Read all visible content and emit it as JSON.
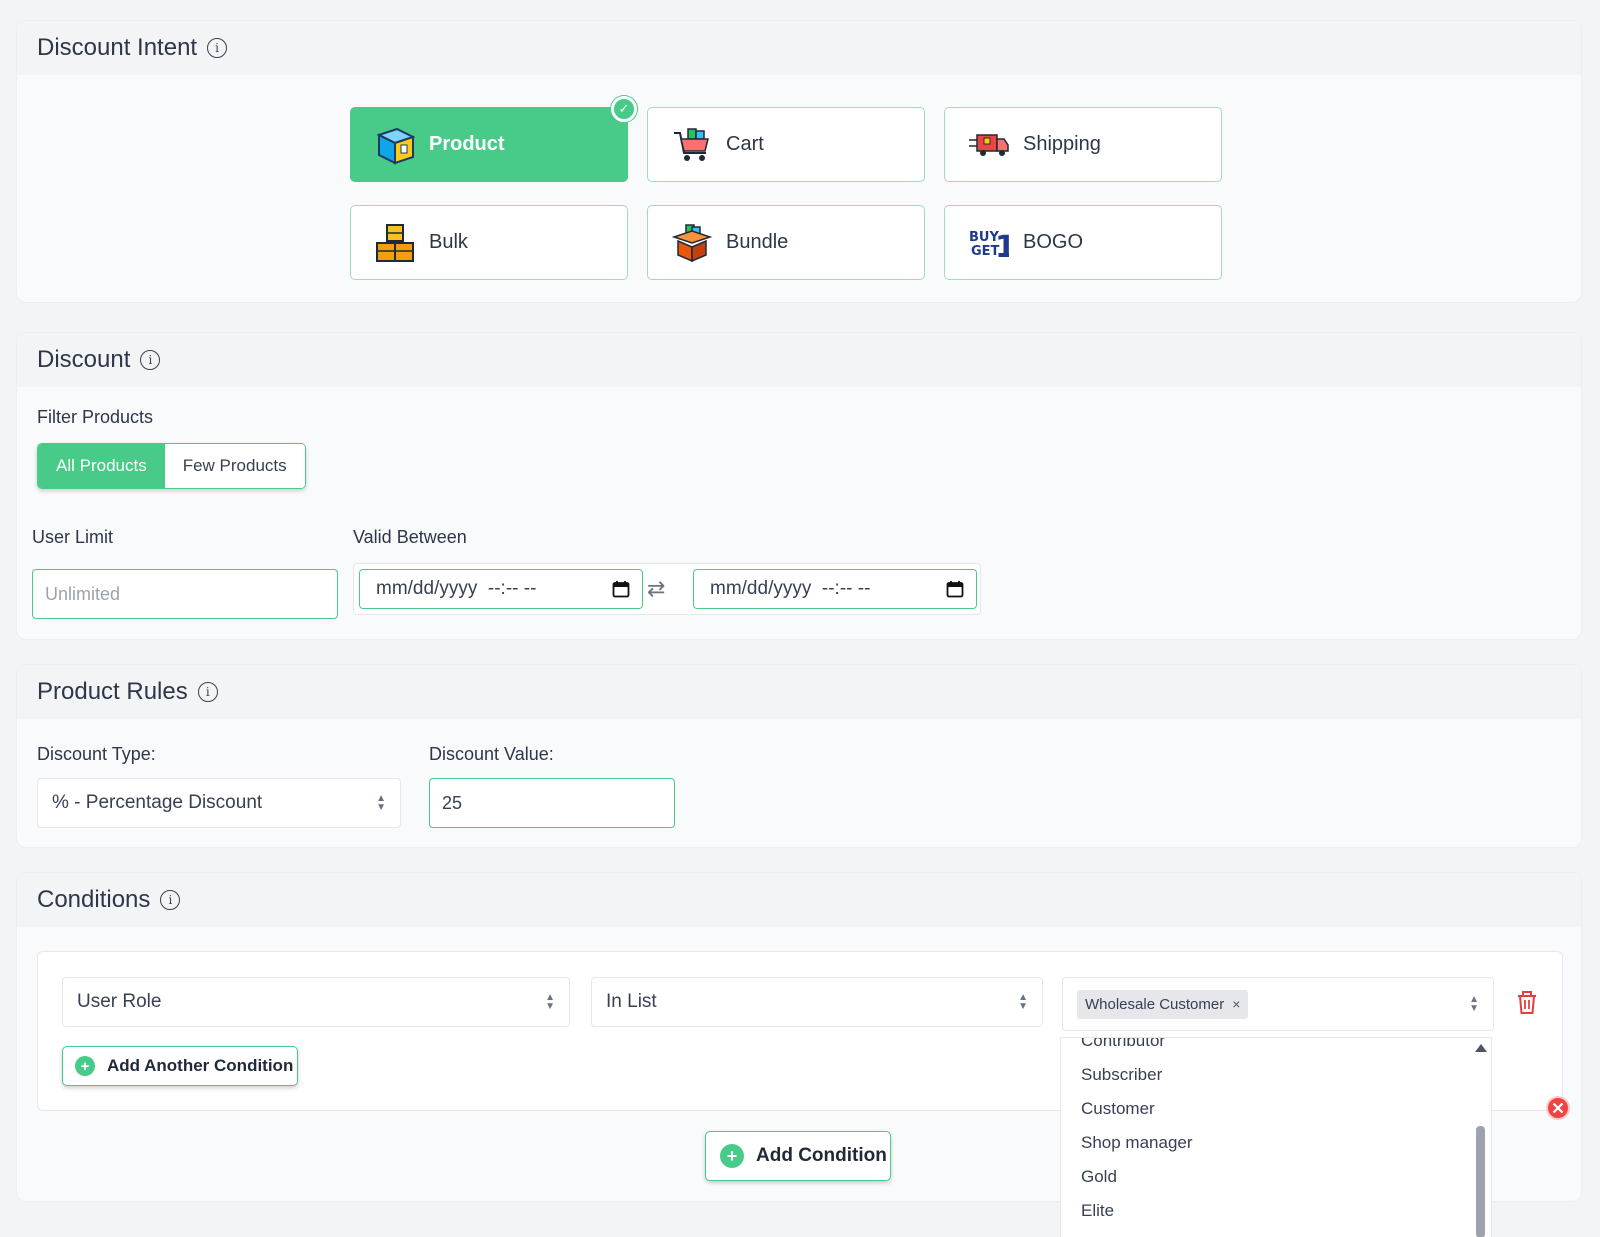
{
  "intent": {
    "title": "Discount Intent",
    "tiles": [
      {
        "label": "Product",
        "icon": "product-box-icon",
        "active": true
      },
      {
        "label": "Cart",
        "icon": "cart-icon"
      },
      {
        "label": "Shipping",
        "icon": "shipping-truck-icon"
      },
      {
        "label": "Bulk",
        "icon": "bulk-boxes-icon"
      },
      {
        "label": "Bundle",
        "icon": "bundle-box-icon"
      },
      {
        "label": "BOGO",
        "icon": "buy1-get1-icon"
      }
    ],
    "bogo_icon_text": {
      "buy": "BUY",
      "get": "GET",
      "num": "1"
    }
  },
  "discount": {
    "title": "Discount",
    "filter_label": "Filter Products",
    "filter_options": [
      "All Products",
      "Few Products"
    ],
    "user_limit_label": "User Limit",
    "user_limit_placeholder": "Unlimited",
    "valid_between_label": "Valid Between",
    "date_placeholder": "mm/dd/yyyy  --:-- --",
    "swap_symbol": "⇄"
  },
  "rules": {
    "title": "Product Rules",
    "type_label": "Discount Type:",
    "type_value": "% - Percentage Discount",
    "value_label": "Discount Value:",
    "value": "25"
  },
  "conditions": {
    "title": "Conditions",
    "field": "User Role",
    "operator": "In List",
    "tag": "Wholesale Customer",
    "tag_remove": "×",
    "add_another": "Add Another Condition",
    "add_condition": "Add Condition",
    "dropdown_options": [
      "Contributor",
      "Subscriber",
      "Customer",
      "Shop manager",
      "Gold",
      "Elite"
    ]
  },
  "colors": {
    "accent": "#48cb88",
    "danger": "#e53e3e"
  }
}
